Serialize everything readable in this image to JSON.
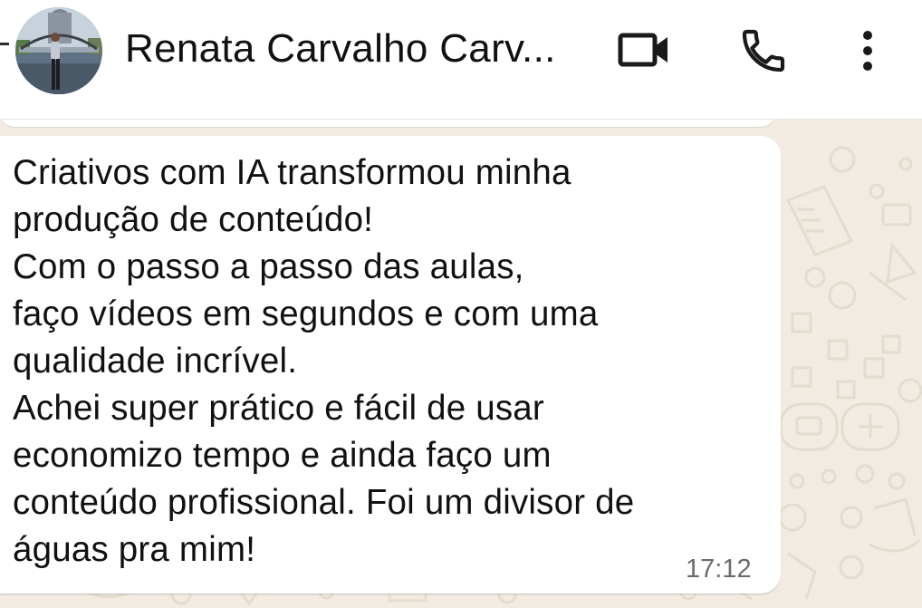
{
  "header": {
    "contact_name": "Renata Carvalho Carv...",
    "icons": {
      "back": "back-arrow-icon",
      "video": "video-call-icon",
      "phone": "voice-call-icon",
      "menu": "more-options-icon"
    }
  },
  "message": {
    "lines": [
      "Criativos com IA transformou minha",
      "produção de conteúdo!",
      "Com o passo a passo das aulas,",
      "faço vídeos em segundos e com uma",
      "qualidade incrível.",
      "Achei super prático e fácil de usar",
      "economizo tempo e ainda faço  um",
      "conteúdo profissional. Foi um divisor de",
      "águas pra mim!"
    ],
    "time": "17:12"
  },
  "colors": {
    "header_bg": "#ffffff",
    "chat_bg": "#f1ebe2",
    "bubble_bg": "#ffffff",
    "text": "#111111",
    "timestamp": "#6b6b6b"
  }
}
